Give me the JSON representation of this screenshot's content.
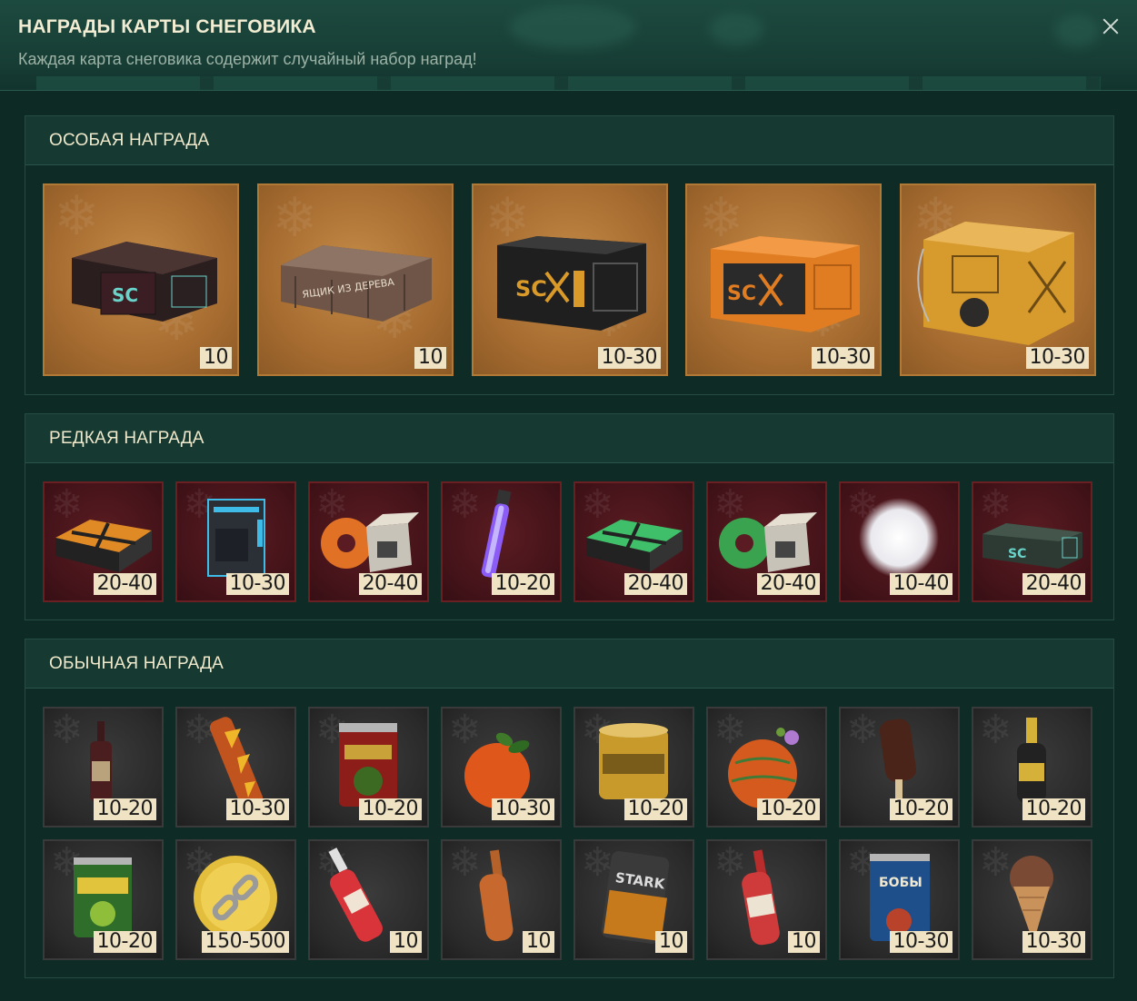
{
  "header": {
    "title": "НАГРАДЫ КАРТЫ СНЕГОВИКА",
    "subtitle": "Каждая карта снеговика содержит случайный набор наград!",
    "close_icon": "close-icon"
  },
  "sections": {
    "special": {
      "title": "ОСОБАЯ НАГРАДА",
      "items": [
        {
          "icon": "sc-dark-crate-icon",
          "qty": "10"
        },
        {
          "icon": "wooden-crate-icon",
          "qty": "10"
        },
        {
          "icon": "black-sc-case-icon",
          "qty": "10-30"
        },
        {
          "icon": "orange-sc-case-icon",
          "qty": "10-30"
        },
        {
          "icon": "yellow-robot-crate-icon",
          "qty": "10-30"
        }
      ]
    },
    "rare": {
      "title": "РЕДКАЯ НАГРАДА",
      "items": [
        {
          "icon": "orange-x-case-icon",
          "qty": "20-40"
        },
        {
          "icon": "blue-neon-container-icon",
          "qty": "10-30"
        },
        {
          "icon": "orange-tape-box-icon",
          "qty": "20-40"
        },
        {
          "icon": "purple-glowstick-icon",
          "qty": "10-20"
        },
        {
          "icon": "green-x-case-icon",
          "qty": "20-40"
        },
        {
          "icon": "green-tape-box-icon",
          "qty": "20-40"
        },
        {
          "icon": "snowball-icon",
          "qty": "10-40"
        },
        {
          "icon": "sc-green-crate-icon",
          "qty": "20-40"
        }
      ]
    },
    "common": {
      "title": "ОБЫЧНАЯ НАГРАДА",
      "items": [
        {
          "icon": "wine-bottle-icon",
          "qty": "10-20"
        },
        {
          "icon": "firecracker-icon",
          "qty": "10-30"
        },
        {
          "icon": "beans-can-icon",
          "qty": "10-20"
        },
        {
          "icon": "tangerine-icon",
          "qty": "10-30"
        },
        {
          "icon": "corn-can-icon",
          "qty": "10-20"
        },
        {
          "icon": "decorated-tangerine-icon",
          "qty": "10-20"
        },
        {
          "icon": "ice-cream-bar-icon",
          "qty": "10-20"
        },
        {
          "icon": "champagne-bottle-icon",
          "qty": "10-20"
        },
        {
          "icon": "peas-can-icon",
          "qty": "10-20"
        },
        {
          "icon": "gold-coin-chain-icon",
          "qty": "150-500"
        },
        {
          "icon": "red-bottle-icon",
          "qty": "10"
        },
        {
          "icon": "orange-bottle-icon",
          "qty": "10"
        },
        {
          "icon": "stark-jar-icon",
          "qty": "10"
        },
        {
          "icon": "ketchup-bottle-icon",
          "qty": "10"
        },
        {
          "icon": "bobi-beans-can-icon",
          "qty": "10-30"
        },
        {
          "icon": "chocolate-ice-cream-icon",
          "qty": "10-30"
        }
      ]
    }
  },
  "colors": {
    "background": "#0e2a24",
    "special_tile": "#b07a36",
    "rare_tile": "#6a1f22",
    "common_tile": "#3a3a3a",
    "badge": "#efe3c4"
  }
}
